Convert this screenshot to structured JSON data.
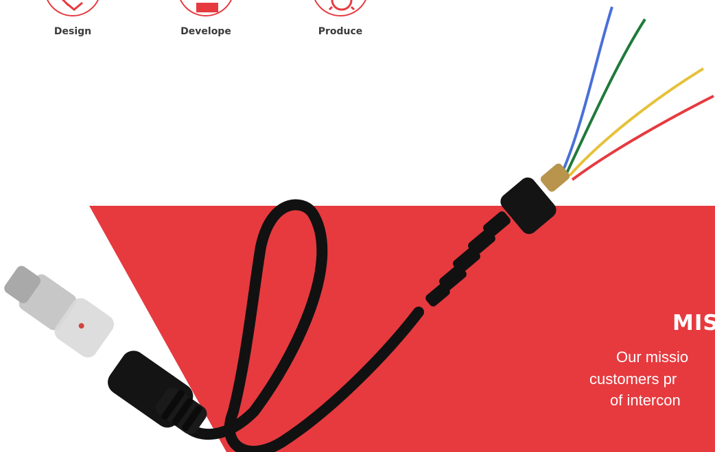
{
  "services": [
    {
      "label": "Design",
      "icon": "design-icon"
    },
    {
      "label": "Develope",
      "icon": "develop-icon"
    },
    {
      "label": "Produce",
      "icon": "produce-icon"
    }
  ],
  "mission": {
    "title": "MIS",
    "lines": [
      "Our missio",
      "customers pr",
      "of intercon"
    ]
  },
  "colors": {
    "accent": "#e63a3f",
    "text_dark": "#3a3a3a",
    "white": "#ffffff",
    "cable": "#111111"
  },
  "image": {
    "subject": "connector-cable-image"
  }
}
